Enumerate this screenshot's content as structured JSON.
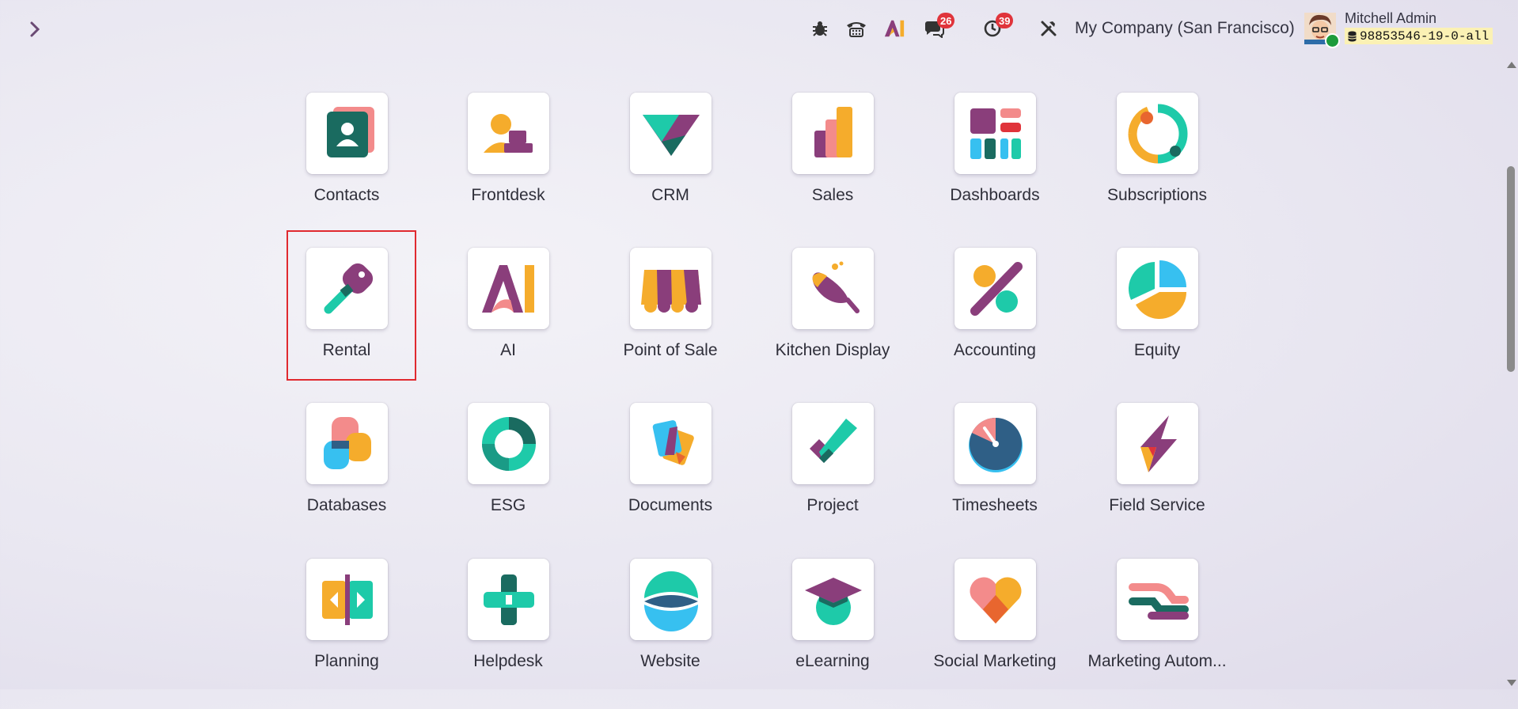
{
  "topbar": {
    "company": "My Company (San Francisco)",
    "user_name": "Mitchell Admin",
    "database": "98853546-19-0-all",
    "ai_label": "AI",
    "chat_count": "26",
    "activity_count": "39"
  },
  "apps": [
    {
      "label": "Contacts"
    },
    {
      "label": "Frontdesk"
    },
    {
      "label": "CRM"
    },
    {
      "label": "Sales"
    },
    {
      "label": "Dashboards"
    },
    {
      "label": "Subscriptions"
    },
    {
      "label": "Rental"
    },
    {
      "label": "AI"
    },
    {
      "label": "Point of Sale"
    },
    {
      "label": "Kitchen Display"
    },
    {
      "label": "Accounting"
    },
    {
      "label": "Equity"
    },
    {
      "label": "Databases"
    },
    {
      "label": "ESG"
    },
    {
      "label": "Documents"
    },
    {
      "label": "Project"
    },
    {
      "label": "Timesheets"
    },
    {
      "label": "Field Service"
    },
    {
      "label": "Planning"
    },
    {
      "label": "Helpdesk"
    },
    {
      "label": "Website"
    },
    {
      "label": "eLearning"
    },
    {
      "label": "Social Marketing"
    },
    {
      "label": "Marketing Autom..."
    }
  ],
  "colors": {
    "teal": "#1ecaa9",
    "purple": "#8a3e7b",
    "orange": "#f5ac2c",
    "pink": "#f38b8b",
    "blue": "#37c0f0",
    "darkteal": "#1a6b60",
    "red": "#e0343b"
  }
}
